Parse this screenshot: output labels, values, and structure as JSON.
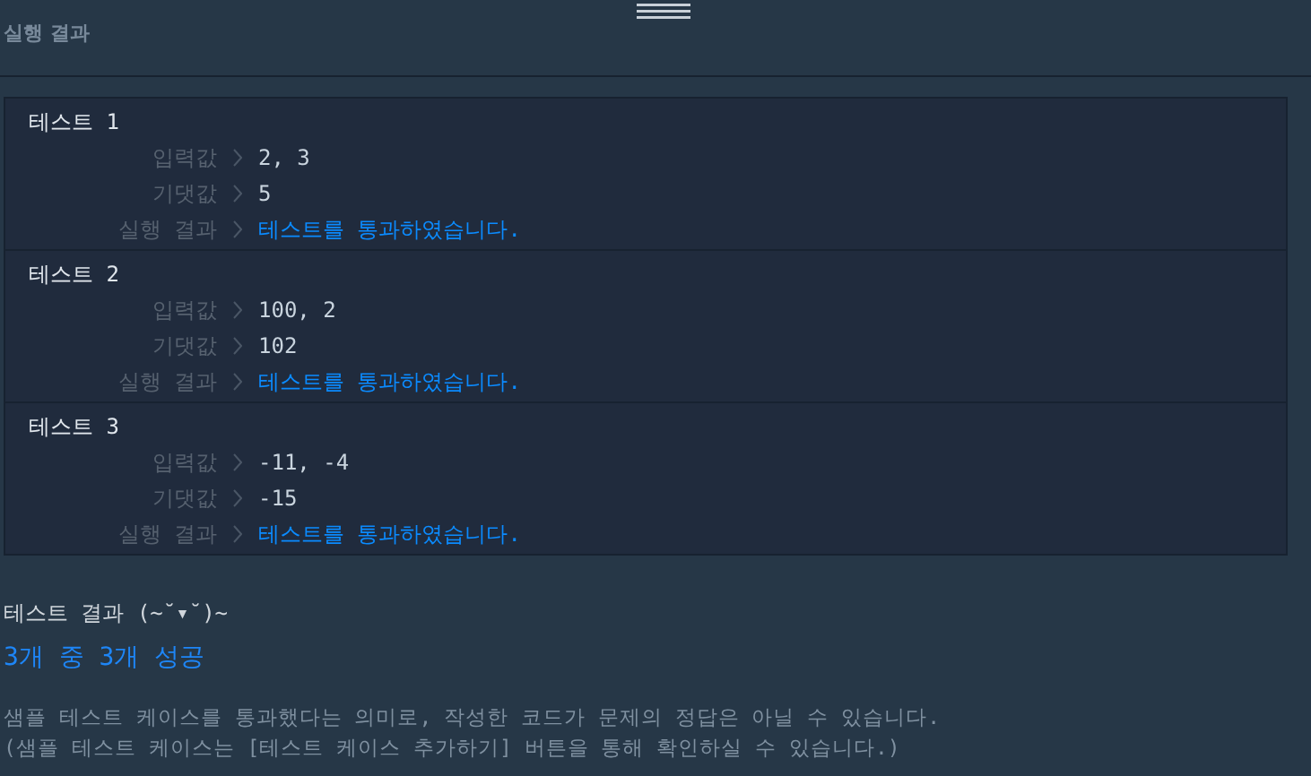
{
  "panel": {
    "title": "실행 결과"
  },
  "tests": [
    {
      "title": "테스트 1",
      "rows": [
        {
          "label": "입력값",
          "value": "2, 3",
          "kind": "plain"
        },
        {
          "label": "기댓값",
          "value": "5",
          "kind": "plain"
        },
        {
          "label": "실행 결과",
          "value": "테스트를 통과하였습니다.",
          "kind": "pass"
        }
      ]
    },
    {
      "title": "테스트 2",
      "rows": [
        {
          "label": "입력값",
          "value": "100, 2",
          "kind": "plain"
        },
        {
          "label": "기댓값",
          "value": "102",
          "kind": "plain"
        },
        {
          "label": "실행 결과",
          "value": "테스트를 통과하였습니다.",
          "kind": "pass"
        }
      ]
    },
    {
      "title": "테스트 3",
      "rows": [
        {
          "label": "입력값",
          "value": "-11, -4",
          "kind": "plain"
        },
        {
          "label": "기댓값",
          "value": "-15",
          "kind": "plain"
        },
        {
          "label": "실행 결과",
          "value": "테스트를 통과하였습니다.",
          "kind": "pass"
        }
      ]
    }
  ],
  "summary": {
    "heading": "테스트 결과 (~˘▾˘)~",
    "score": "3개 중 3개 성공",
    "notes": [
      "샘플 테스트 케이스를 통과했다는 의미로, 작성한 코드가 문제의 정답은 아닐 수 있습니다.",
      "(샘플 테스트 케이스는 [테스트 케이스 추가하기] 버튼을 통해 확인하실 수 있습니다.)"
    ]
  }
}
